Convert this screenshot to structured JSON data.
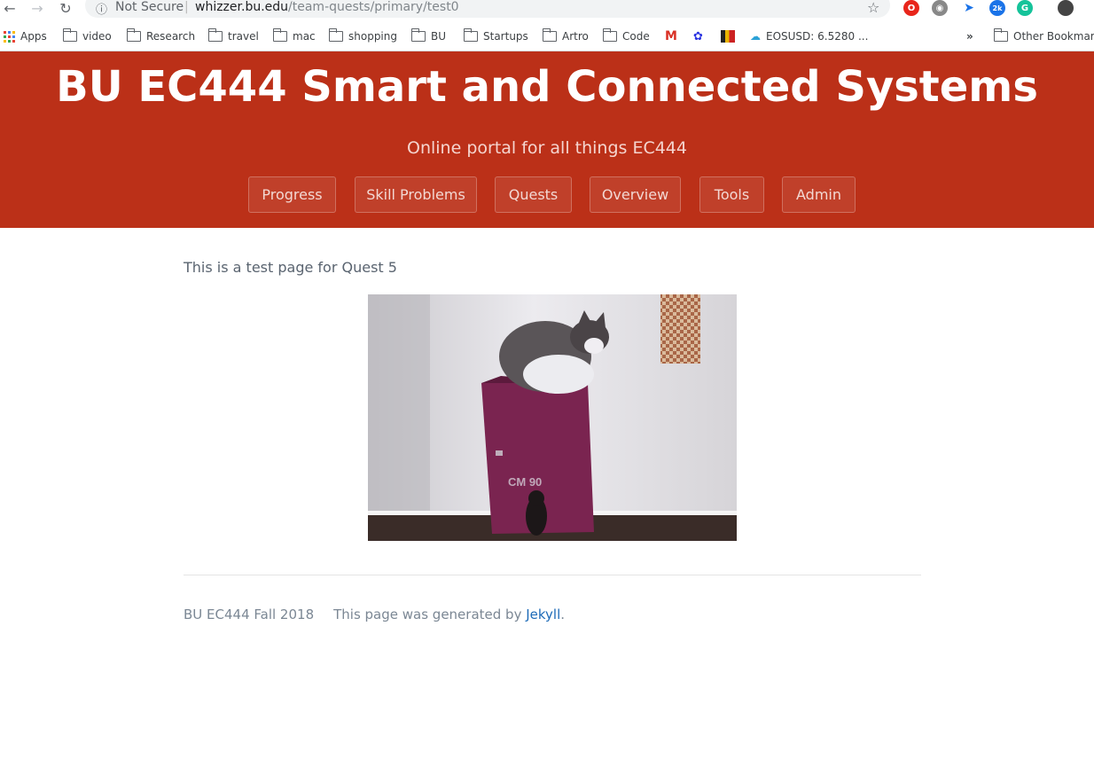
{
  "browser": {
    "security_label": "Not Secure",
    "url_domain": "whizzer.bu.edu",
    "url_path": "/team-quests/primary/test0",
    "extension_badge": "2k"
  },
  "bookmarks": {
    "apps": "Apps",
    "items": [
      "video",
      "Research",
      "travel",
      "mac",
      "shopping",
      "BU",
      "Startups",
      "Artro",
      "Code"
    ],
    "eos": "EOSUSD: 6.5280 ...",
    "more": "»",
    "other": "Other Bookmarks"
  },
  "header": {
    "title": "BU EC444 Smart and Connected Systems",
    "tagline": "Online portal for all things EC444",
    "nav": [
      "Progress",
      "Skill Problems",
      "Quests",
      "Overview",
      "Tools",
      "Admin"
    ]
  },
  "content": {
    "text": "This is a test page for Quest 5",
    "gif_text": "CM 90"
  },
  "footer": {
    "course": "BU EC444 Fall 2018",
    "generated_prefix": "This page was generated by ",
    "generator_link": "Jekyll",
    "suffix": "."
  },
  "colors": {
    "header_bg": "#bb3018",
    "link": "#1e6bb8"
  }
}
